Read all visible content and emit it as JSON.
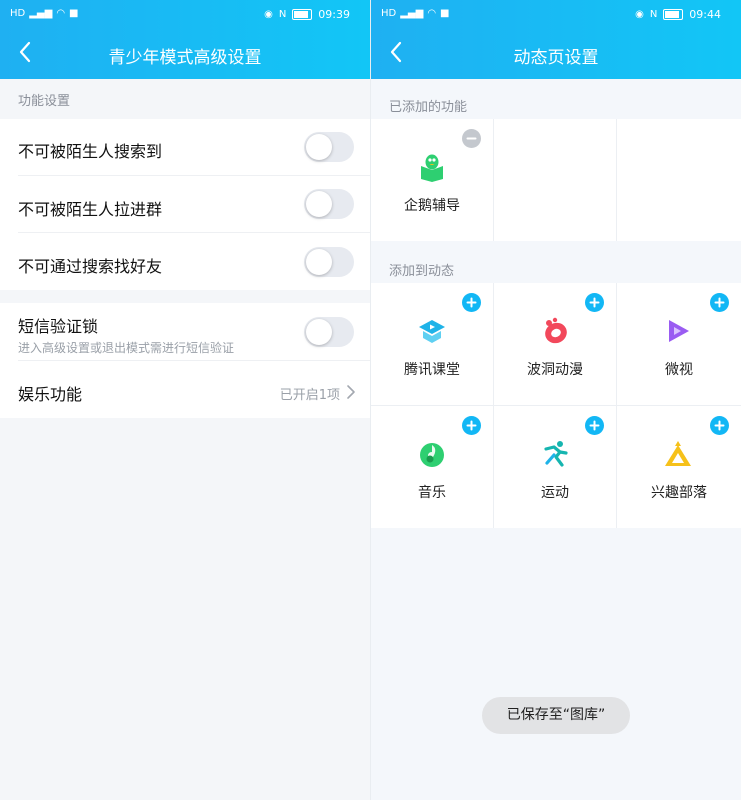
{
  "left": {
    "status": {
      "time": "09:39"
    },
    "title": "青少年模式高级设置",
    "section": "功能设置",
    "rows": [
      {
        "label": "不可被陌生人搜索到"
      },
      {
        "label": "不可被陌生人拉进群"
      },
      {
        "label": "不可通过搜索找好友"
      }
    ],
    "sms": {
      "label": "短信验证锁",
      "sub": "进入高级设置或退出模式需进行短信验证"
    },
    "entertainment": {
      "label": "娱乐功能",
      "value": "已开启1项"
    }
  },
  "right": {
    "status": {
      "time": "09:44"
    },
    "title": "动态页设置",
    "added_section": "已添加的功能",
    "added": [
      {
        "label": "企鹅辅导",
        "icon": "penguin-book-icon",
        "color": "#2ecf71"
      }
    ],
    "add_section": "添加到动态",
    "available": [
      {
        "label": "腾讯课堂",
        "icon": "tencent-classroom-icon",
        "color": "#1fb3e8"
      },
      {
        "label": "波洞动漫",
        "icon": "bodong-anime-icon",
        "color": "#f2485b"
      },
      {
        "label": "微视",
        "icon": "weishi-icon",
        "color": "#9a5cf2"
      },
      {
        "label": "音乐",
        "icon": "music-icon",
        "color": "#2ecf71"
      },
      {
        "label": "运动",
        "icon": "sports-icon",
        "color": "#16b5b0"
      },
      {
        "label": "兴趣部落",
        "icon": "interest-tribe-icon",
        "color": "#f6c11a"
      }
    ],
    "toast": "已保存至“图库”"
  },
  "colors": {
    "header_accent": "#1fb0f2",
    "add_badge": "#12b7f5",
    "remove_badge": "#c4c8ce"
  }
}
